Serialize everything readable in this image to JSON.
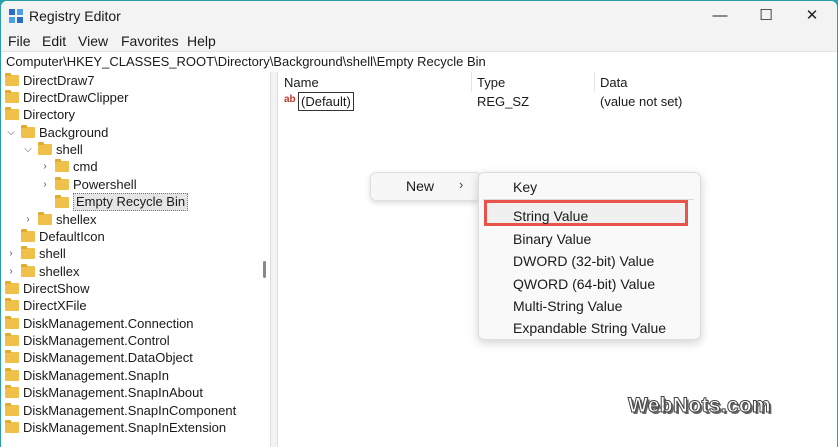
{
  "window": {
    "title": "Registry Editor",
    "controls": {
      "minimize": "—",
      "maximize": "☐",
      "close": "✕"
    }
  },
  "menu": [
    "File",
    "Edit",
    "View",
    "Favorites",
    "Help"
  ],
  "address": "Computer\\HKEY_CLASSES_ROOT\\Directory\\Background\\shell\\Empty Recycle Bin",
  "tree": [
    "DirectDraw7",
    "DirectDrawClipper",
    "Directory",
    "Background",
    "shell",
    "cmd",
    "Powershell",
    "Empty Recycle Bin",
    "shellex",
    "DefaultIcon",
    "shell",
    "shellex",
    "DirectShow",
    "DirectXFile",
    "DiskManagement.Connection",
    "DiskManagement.Control",
    "DiskManagement.DataObject",
    "DiskManagement.SnapIn",
    "DiskManagement.SnapInAbout",
    "DiskManagement.SnapInComponent",
    "DiskManagement.SnapInExtension"
  ],
  "values": {
    "headers": {
      "name": "Name",
      "type": "Type",
      "data": "Data"
    },
    "rows": [
      {
        "icon": "ab",
        "name": "(Default)",
        "type": "REG_SZ",
        "data": "(value not set)"
      }
    ]
  },
  "context_menu": {
    "new_label": "New",
    "arrow": "›"
  },
  "submenu": [
    "Key",
    "String Value",
    "Binary Value",
    "DWORD (32-bit) Value",
    "QWORD (64-bit) Value",
    "Multi-String Value",
    "Expandable String Value"
  ],
  "watermark": "WebNots.com",
  "colors": {
    "highlight_border": "#e8544a",
    "folder": "#f0c14a",
    "background": "#2a9fa9"
  }
}
